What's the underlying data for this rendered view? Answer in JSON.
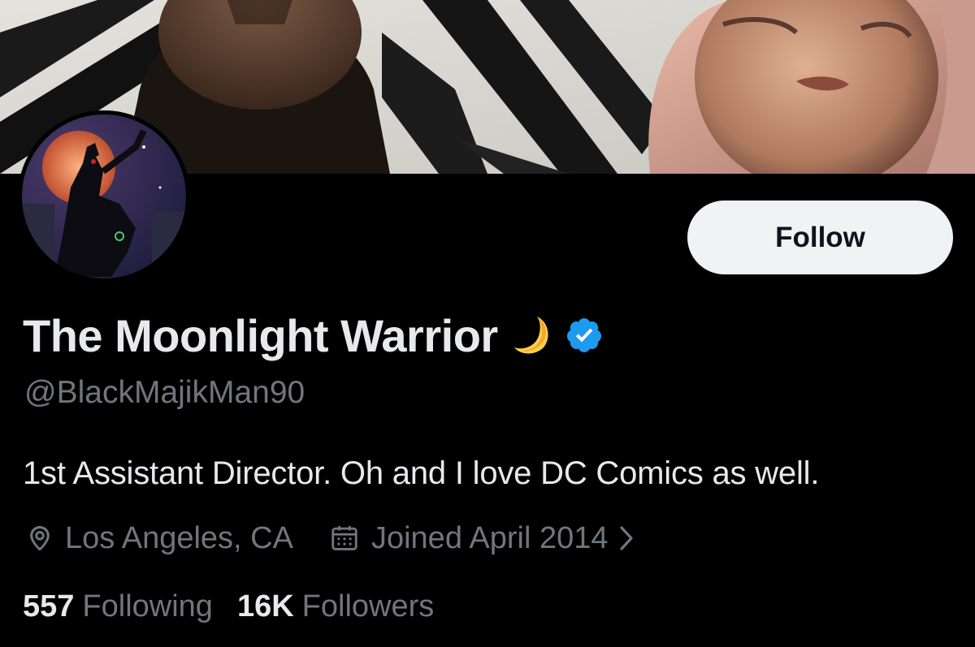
{
  "profile": {
    "display_name": "The Moonlight Warrior",
    "display_name_emoji": "crescent-moon",
    "verified": true,
    "handle": "@BlackMajikMan90",
    "bio": "1st Assistant Director. Oh and I love DC Comics as well.",
    "location": "Los Angeles, CA",
    "joined": "Joined April 2014"
  },
  "actions": {
    "follow_label": "Follow"
  },
  "stats": {
    "following_count": "557",
    "following_label": "Following",
    "followers_count": "16K",
    "followers_label": "Followers"
  },
  "icons": {
    "location": "location-pin-icon",
    "joined": "calendar-icon",
    "more": "chevron-right-icon",
    "verified": "verified-badge-icon"
  },
  "colors": {
    "background": "#000000",
    "primary_text": "#e7e9ea",
    "secondary_text": "#71767b",
    "follow_button_bg": "#eff3f4",
    "verified_blue": "#1d9bf0",
    "moon_yellow": "#ffcf4a"
  }
}
